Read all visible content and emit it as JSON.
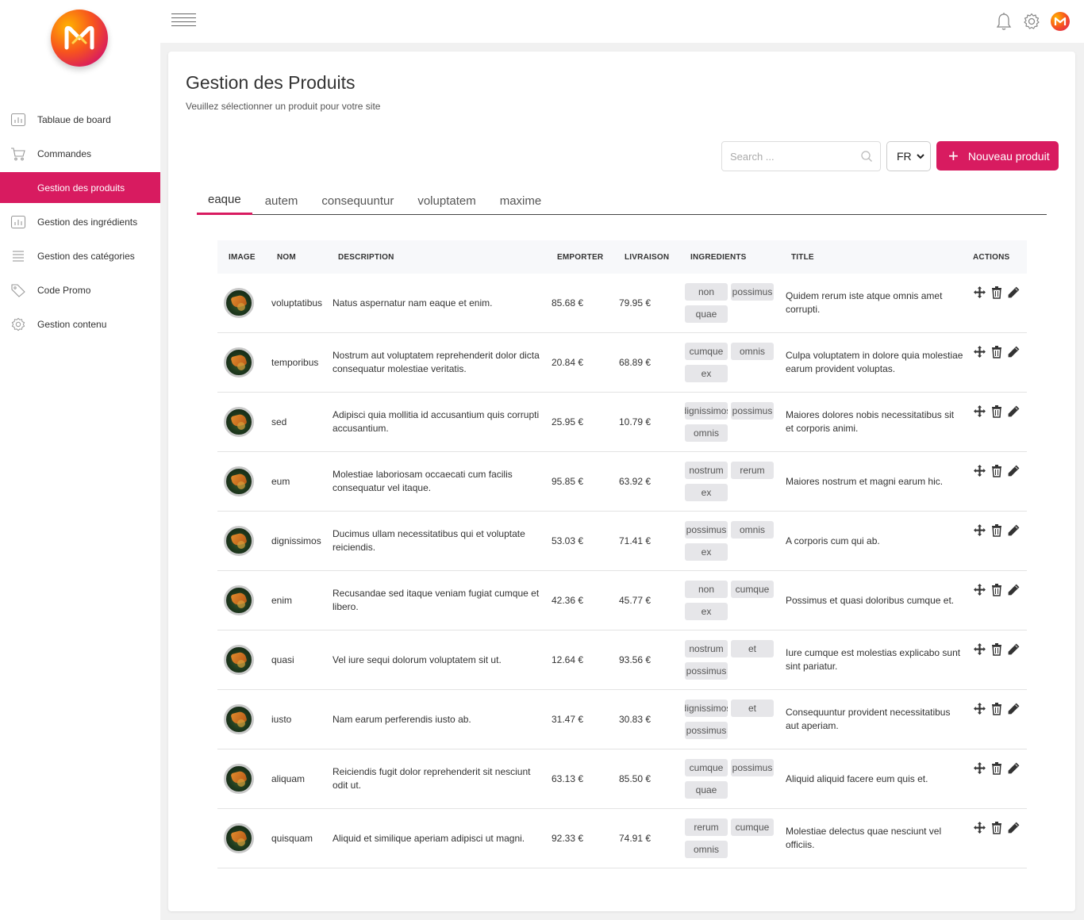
{
  "sidebar": {
    "items": [
      {
        "label": "Tablaue de board",
        "icon": "chart-icon"
      },
      {
        "label": "Commandes",
        "icon": "cart-icon"
      },
      {
        "label": "Gestion des produits",
        "icon": "list-icon",
        "active": true
      },
      {
        "label": "Gestion des ingrédients",
        "icon": "chart-icon"
      },
      {
        "label": "Gestion des catégories",
        "icon": "list-icon"
      },
      {
        "label": "Code Promo",
        "icon": "tag-icon"
      },
      {
        "label": "Gestion contenu",
        "icon": "gear-icon"
      }
    ]
  },
  "header": {
    "icons": [
      "bell-icon",
      "gear-icon",
      "user-avatar"
    ]
  },
  "main": {
    "title": "Gestion des Produits",
    "subtitle": "Veuillez sélectionner un produit pour votre site",
    "search_placeholder": "Search ...",
    "lang_value": "FR",
    "new_button_label": "Nouveau produit",
    "tabs": [
      "eaque",
      "autem",
      "consequuntur",
      "voluptatem",
      "maxime"
    ],
    "active_tab": "eaque",
    "columns": [
      "IMAGE",
      "NOM",
      "DESCRIPTION",
      "EMPORTER",
      "LIVRAISON",
      "INGREDIENTS",
      "TITLE",
      "ACTIONS"
    ],
    "rows": [
      {
        "nom": "voluptatibus",
        "description": "Natus aspernatur nam eaque et enim.",
        "emporter": "85.68 €",
        "livraison": "79.95 €",
        "ingredients": [
          "non",
          "possimus",
          "quae"
        ],
        "title": "Quidem rerum iste atque omnis amet corrupti."
      },
      {
        "nom": "temporibus",
        "description": "Nostrum aut voluptatem reprehenderit dolor dicta consequatur molestiae veritatis.",
        "emporter": "20.84 €",
        "livraison": "68.89 €",
        "ingredients": [
          "cumque",
          "omnis",
          "ex"
        ],
        "title": "Culpa voluptatem in dolore quia molestiae earum provident voluptas."
      },
      {
        "nom": "sed",
        "description": "Adipisci quia mollitia id accusantium quis corrupti accusantium.",
        "emporter": "25.95 €",
        "livraison": "10.79 €",
        "ingredients": [
          "dignissimos",
          "possimus",
          "omnis"
        ],
        "title": "Maiores dolores nobis necessitatibus sit et corporis animi."
      },
      {
        "nom": "eum",
        "description": "Molestiae laboriosam occaecati cum facilis consequatur vel itaque.",
        "emporter": "95.85 €",
        "livraison": "63.92 €",
        "ingredients": [
          "nostrum",
          "rerum",
          "ex"
        ],
        "title": "Maiores nostrum et magni earum hic."
      },
      {
        "nom": "dignissimos",
        "description": "Ducimus ullam necessitatibus qui et voluptate reiciendis.",
        "emporter": "53.03 €",
        "livraison": "71.41 €",
        "ingredients": [
          "possimus",
          "omnis",
          "ex"
        ],
        "title": "A corporis cum qui ab."
      },
      {
        "nom": "enim",
        "description": "Recusandae sed itaque veniam fugiat cumque et libero.",
        "emporter": "42.36 €",
        "livraison": "45.77 €",
        "ingredients": [
          "non",
          "cumque",
          "ex"
        ],
        "title": "Possimus et quasi doloribus cumque et."
      },
      {
        "nom": "quasi",
        "description": "Vel iure sequi dolorum voluptatem sit ut.",
        "emporter": "12.64 €",
        "livraison": "93.56 €",
        "ingredients": [
          "nostrum",
          "et",
          "possimus"
        ],
        "title": "Iure cumque est molestias explicabo sunt sint pariatur."
      },
      {
        "nom": "iusto",
        "description": "Nam earum perferendis iusto ab.",
        "emporter": "31.47 €",
        "livraison": "30.83 €",
        "ingredients": [
          "dignissimos",
          "et",
          "possimus"
        ],
        "title": "Consequuntur provident necessitatibus aut aperiam."
      },
      {
        "nom": "aliquam",
        "description": "Reiciendis fugit dolor reprehenderit sit nesciunt odit ut.",
        "emporter": "63.13 €",
        "livraison": "85.50 €",
        "ingredients": [
          "cumque",
          "possimus",
          "quae"
        ],
        "title": "Aliquid aliquid facere eum quis et."
      },
      {
        "nom": "quisquam",
        "description": "Aliquid et similique aperiam adipisci ut magni.",
        "emporter": "92.33 €",
        "livraison": "74.91 €",
        "ingredients": [
          "rerum",
          "cumque",
          "omnis"
        ],
        "title": "Molestiae delectus quae nesciunt vel officiis."
      }
    ]
  },
  "colors": {
    "accent": "#d81b60",
    "background": "#f1f1f1",
    "chip": "#e6e6e9"
  }
}
